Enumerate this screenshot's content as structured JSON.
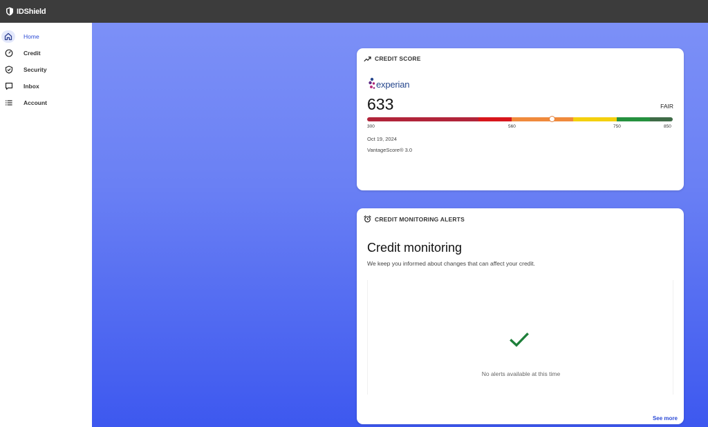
{
  "app": {
    "brand": "IDShield"
  },
  "sidebar": {
    "items": [
      {
        "label": "Home",
        "icon": "home-icon",
        "active": true
      },
      {
        "label": "Credit",
        "icon": "gauge-icon",
        "active": false
      },
      {
        "label": "Security",
        "icon": "shield-check-icon",
        "active": false
      },
      {
        "label": "Inbox",
        "icon": "message-icon",
        "active": false
      },
      {
        "label": "Account",
        "icon": "list-icon",
        "active": false
      }
    ]
  },
  "credit_score": {
    "header": "CREDIT SCORE",
    "header_icon": "trending-up-icon",
    "bureau": "experian",
    "score": "633",
    "rating": "FAIR",
    "scale": {
      "min": 300,
      "max": 850,
      "value": 633
    },
    "ticks": [
      "300",
      "560",
      "750",
      "850"
    ],
    "segments": [
      {
        "color": "#b1243a"
      },
      {
        "color": "#d7161c"
      },
      {
        "color": "#f08a3c"
      },
      {
        "color": "#f4d00e"
      },
      {
        "color": "#25913f"
      },
      {
        "color": "#3f6b47"
      }
    ],
    "date": "Oct 19, 2024",
    "model": "VantageScore® 3.0"
  },
  "alerts": {
    "header": "CREDIT MONITORING ALERTS",
    "header_icon": "alarm-clock-icon",
    "title": "Credit monitoring",
    "subtitle": "We keep you informed about changes that can affect your credit.",
    "empty_message": "No alerts available at this time",
    "empty_icon": "check-icon",
    "check_color": "#1e7f3a",
    "see_more": "See more"
  }
}
